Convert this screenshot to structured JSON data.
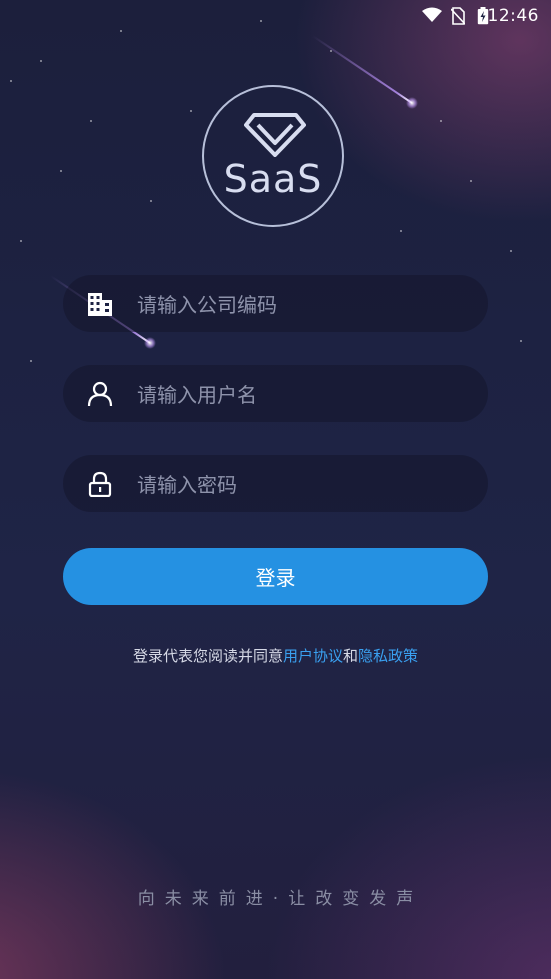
{
  "status_bar": {
    "time": "12:46",
    "icons": [
      "wifi-icon",
      "no-sim-icon",
      "battery-charging-icon"
    ]
  },
  "logo": {
    "text": "SaaS",
    "icon": "diamond-icon"
  },
  "form": {
    "company": {
      "placeholder": "请输入公司编码",
      "value": "",
      "icon": "building-icon"
    },
    "username": {
      "placeholder": "请输入用户名",
      "value": "",
      "icon": "user-icon"
    },
    "password": {
      "placeholder": "请输入密码",
      "value": "",
      "icon": "lock-icon"
    },
    "login_label": "登录"
  },
  "agreement": {
    "prefix": "登录代表您阅读并同意",
    "user_agreement": "用户协议",
    "and": "和",
    "privacy_policy": "隐私政策"
  },
  "slogan": "向未来前进·让改变发声",
  "colors": {
    "accent": "#2591e2",
    "link": "#3aa0f0",
    "background": "#1d2242"
  }
}
